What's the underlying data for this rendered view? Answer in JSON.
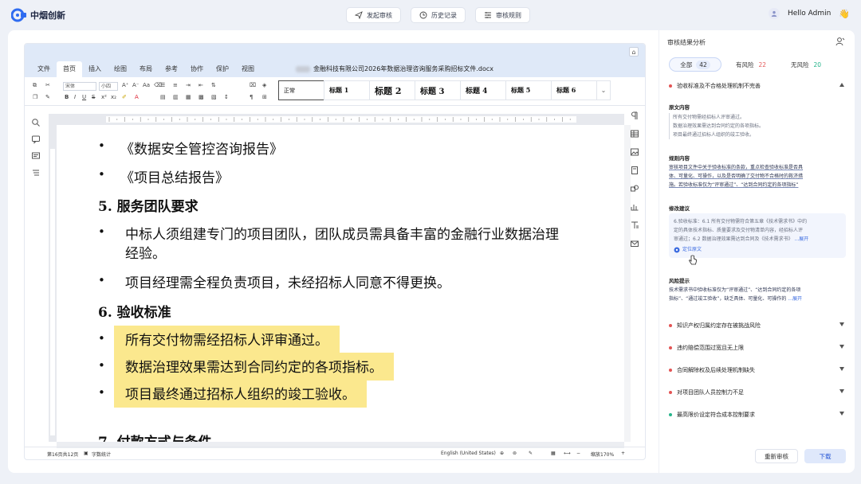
{
  "brand": {
    "name": "中烟创新"
  },
  "nav": {
    "items": [
      {
        "label": "发起审核",
        "icon": "send-icon"
      },
      {
        "label": "历史记录",
        "icon": "clock-icon"
      },
      {
        "label": "审核规则",
        "icon": "list-icon"
      }
    ]
  },
  "user": {
    "greeting": "Hello Admin",
    "emoji": "👋"
  },
  "doc": {
    "menu": [
      "文件",
      "首页",
      "插入",
      "绘图",
      "布局",
      "参考",
      "协作",
      "保护",
      "视图"
    ],
    "active_menu": "首页",
    "title": "金融科技有限公司2026年数据治理咨询服务采购招标文件.docx",
    "font_name": "宋体",
    "font_size": "小四",
    "styles": [
      "正常",
      "标题 1",
      "标题 2",
      "标题 3",
      "标题 4",
      "标题 5",
      "标题 6"
    ],
    "lines": {
      "b1": "《数据安全管控咨询报告》",
      "b2": "《项目总结报告》",
      "h5": "5.  服务团队要求",
      "b3a": "中标人须组建专门的项目团队，团队成员需具备丰富的金融行业数据治理",
      "b3b": "经验。",
      "b4": "项目经理需全程负责项目，未经招标人同意不得更换。",
      "h6": "6.  验收标准",
      "hl1": "所有交付物需经招标人评审通过。",
      "hl2": "数据治理效果需达到合同约定的各项指标。",
      "hl3": "项目最终通过招标人组织的竣工验收。",
      "cut": "7.  付款方式与条件"
    },
    "status": {
      "page": "第16页共12页",
      "wordcount": "字数统计",
      "lang": "English (United States)",
      "zoom": "缩放170%"
    }
  },
  "analysis": {
    "title": "审核结果分析",
    "tabs": [
      {
        "label": "全部",
        "count": "42"
      },
      {
        "label": "有风险",
        "count": "22"
      },
      {
        "label": "无风险",
        "count": "20"
      }
    ],
    "expanded": {
      "title": "验收标准及不合格处理机制不完善",
      "original_label": "原文内容",
      "original_lines": [
        "所有交付物需经招标人评审通过。",
        "数据治理效果需达到合同约定的各项指标。",
        "项目最终通过招标人组织的竣工验收。"
      ],
      "rule_label": "规则内容",
      "rule_lines": [
        "审核项目文件中关于验收标准的条款，重点检查验收标准是否具",
        "体、可量化、可操作，以及是否明确了交付物不合格时的救济措",
        "施。若验收标准仅为“评审通过”、“达到合同约定的各项指标”"
      ],
      "suggest_label": "修改建议",
      "suggest_lines": [
        "6.验收标准：6.1 所有交付物需符合第五章《技术需求书》中约",
        "定的具体技术指标、质量要求及交付物清单内容，经招标人评",
        "审通过；6.2 数据治理效果需达到合同及《技术需求书》"
      ],
      "expand": "...展开",
      "locate": "定位原文",
      "hint_label": "风险提示",
      "hint_lines": [
        "技术需求书中验收标准仅为“评审通过”、“达到合同约定的各项",
        "指标”、“通过竣工验收”，缺乏具体、可量化、可操作的"
      ],
      "hint_expand": "...展开"
    },
    "issues": [
      {
        "title": "知识产权归属约定存在被挑战风险",
        "risk": true
      },
      {
        "title": "违约赔偿范围过宽且无上限",
        "risk": true
      },
      {
        "title": "合同解除权及后续处理机制缺失",
        "risk": true
      },
      {
        "title": "对项目团队人员控制力不足",
        "risk": true
      },
      {
        "title": "最高限价设定符合成本控制要求",
        "risk": false
      }
    ],
    "buttons": {
      "recheck": "重新审核",
      "download": "下载"
    }
  },
  "colors": {
    "accent": "#2c5bd7",
    "risk": "#e35454",
    "safe": "#27b58b",
    "highlight": "#fbe88e"
  }
}
